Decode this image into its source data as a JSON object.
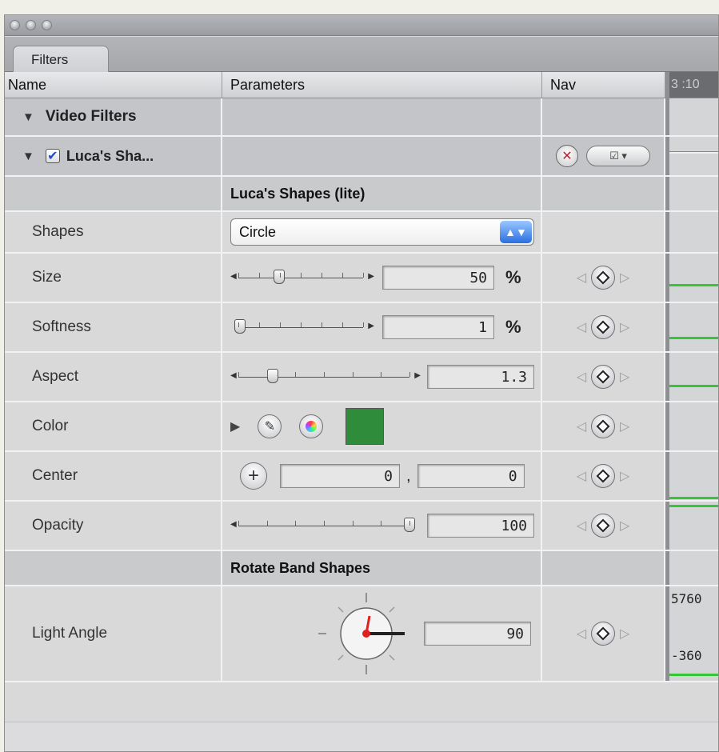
{
  "window": {
    "tab_label": "Filters"
  },
  "columns": {
    "name": "Name",
    "parameters": "Parameters",
    "nav": "Nav",
    "timecode": "3 :10"
  },
  "tree": {
    "video_filters_label": "Video Filters",
    "filter_label": "Luca's Sha...",
    "filter_enabled": true
  },
  "section1_title": "Luca's Shapes (lite)",
  "section2_title": "Rotate  Band Shapes",
  "params": {
    "shapes": {
      "label": "Shapes",
      "value": "Circle"
    },
    "size": {
      "label": "Size",
      "value": "50",
      "unit": "%",
      "slider_fraction": 0.33
    },
    "softness": {
      "label": "Softness",
      "value": "1",
      "unit": "%",
      "slider_fraction": 0.01
    },
    "aspect": {
      "label": "Aspect",
      "value": "1.3",
      "slider_fraction": 0.2
    },
    "color": {
      "label": "Color",
      "swatch": "#2f8c3a"
    },
    "center": {
      "label": "Center",
      "x": "0",
      "separator": ",",
      "y": "0"
    },
    "opacity": {
      "label": "Opacity",
      "value": "100",
      "slider_fraction": 1.0
    },
    "light_angle": {
      "label": "Light Angle",
      "value": "90"
    }
  },
  "timeline": {
    "upper_label": "5760",
    "lower_label": "-360",
    "curve_color": "#34c634"
  }
}
